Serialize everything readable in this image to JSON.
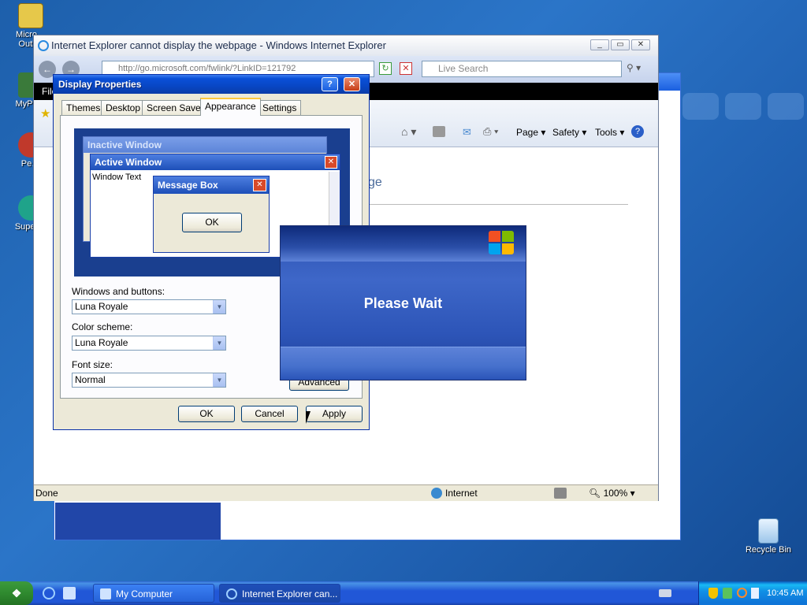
{
  "desktop": {
    "icons": [
      {
        "label": "Micro… Outl…"
      },
      {
        "label": "MyPa…"
      },
      {
        "label": "Pe…"
      },
      {
        "label": "Super…"
      },
      {
        "label": "Recycle Bin"
      }
    ]
  },
  "ie": {
    "title": "Internet Explorer cannot display the webpage - Windows Internet Explorer",
    "address": "http://go.microsoft.com/fwlink/?LinkID=121792",
    "search_placeholder": "Live Search",
    "menu_first": "File",
    "toolbar": {
      "page": "Page",
      "safety": "Safety",
      "tools": "Tools"
    },
    "page_heading_fragment": "ge",
    "status": {
      "text": "Done",
      "zone": "Internet",
      "zoom": "100%"
    }
  },
  "display_properties": {
    "title": "Display Properties",
    "tabs": [
      "Themes",
      "Desktop",
      "Screen Saver",
      "Appearance",
      "Settings"
    ],
    "preview": {
      "inactive_title": "Inactive Window",
      "active_title": "Active Window",
      "window_text": "Window Text",
      "message_box_title": "Message Box",
      "ok": "OK"
    },
    "windows_buttons_label": "Windows and buttons:",
    "windows_buttons_value": "Luna Royale",
    "color_scheme_label": "Color scheme:",
    "color_scheme_value": "Luna Royale",
    "font_size_label": "Font size:",
    "font_size_value": "Normal",
    "advanced": "Advanced",
    "ok": "OK",
    "cancel": "Cancel",
    "apply": "Apply"
  },
  "please_wait": "Please Wait",
  "taskbar": {
    "items": [
      "My Computer",
      "Internet Explorer can..."
    ],
    "clock": "10:45 AM"
  },
  "colors": {
    "xp_blue": "#0a50d8",
    "royale_blue": "#2b4fb0"
  }
}
